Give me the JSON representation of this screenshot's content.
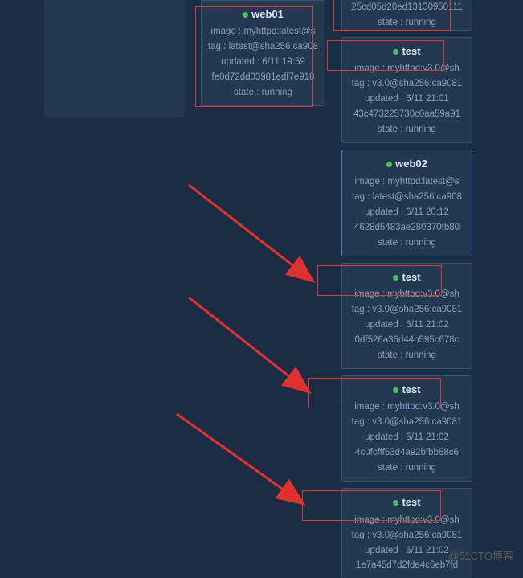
{
  "watermark": "@51CTO博客",
  "empty_panel": {},
  "column_mid": {
    "cards": [
      {
        "name": "web01",
        "status_color": "#4ac261",
        "image": "image : myhttpd:latest@s",
        "tag": "tag : latest@sha256:ca908",
        "updated": "updated : 6/11 19:59",
        "hash": "fe0d72dd03981edf7e918",
        "state": "state : running"
      }
    ]
  },
  "column_right": {
    "cards": [
      {
        "name": "",
        "partial_top": true,
        "image": "",
        "tag": "",
        "updated": "",
        "hash": "25cd05d20ed13130950111",
        "state": "state : running"
      },
      {
        "name": "test",
        "status_color": "#4ac261",
        "image": "image : myhttpd:v3.0@sh",
        "tag": "tag : v3.0@sha256:ca9081",
        "updated": "updated : 6/11 21:01",
        "hash": "43c473225730c0aa59a91",
        "state": "state : running"
      },
      {
        "name": "web02",
        "status_color": "#4ac261",
        "highlighted": true,
        "image": "image : myhttpd:latest@s",
        "tag": "tag : latest@sha256:ca908",
        "updated": "updated : 6/11 20:12",
        "hash": "4628d5483ae280370fb80",
        "state": "state : running"
      },
      {
        "name": "test",
        "status_color": "#4ac261",
        "image": "image : myhttpd:v3.0@sh",
        "tag": "tag : v3.0@sha256:ca9081",
        "updated": "updated : 6/11 21:02",
        "hash": "0df526a36d44b595c678c",
        "state": "state : running"
      },
      {
        "name": "test",
        "status_color": "#4ac261",
        "image": "image : myhttpd:v3.0@sh",
        "tag": "tag : v3.0@sha256:ca9081",
        "updated": "updated : 6/11 21:02",
        "hash": "4c0fcfff53d4a92bfbb68c6",
        "state": "state : running"
      },
      {
        "name": "test",
        "status_color": "#4ac261",
        "partial_bottom": true,
        "image": "image : myhttpd:v3.0@sh",
        "tag": "tag : v3.0@sha256:ca9081",
        "updated": "updated : 6/11 21:02",
        "hash": "1e7a45d7d2fde4c6eb7fd",
        "state": ""
      }
    ]
  }
}
